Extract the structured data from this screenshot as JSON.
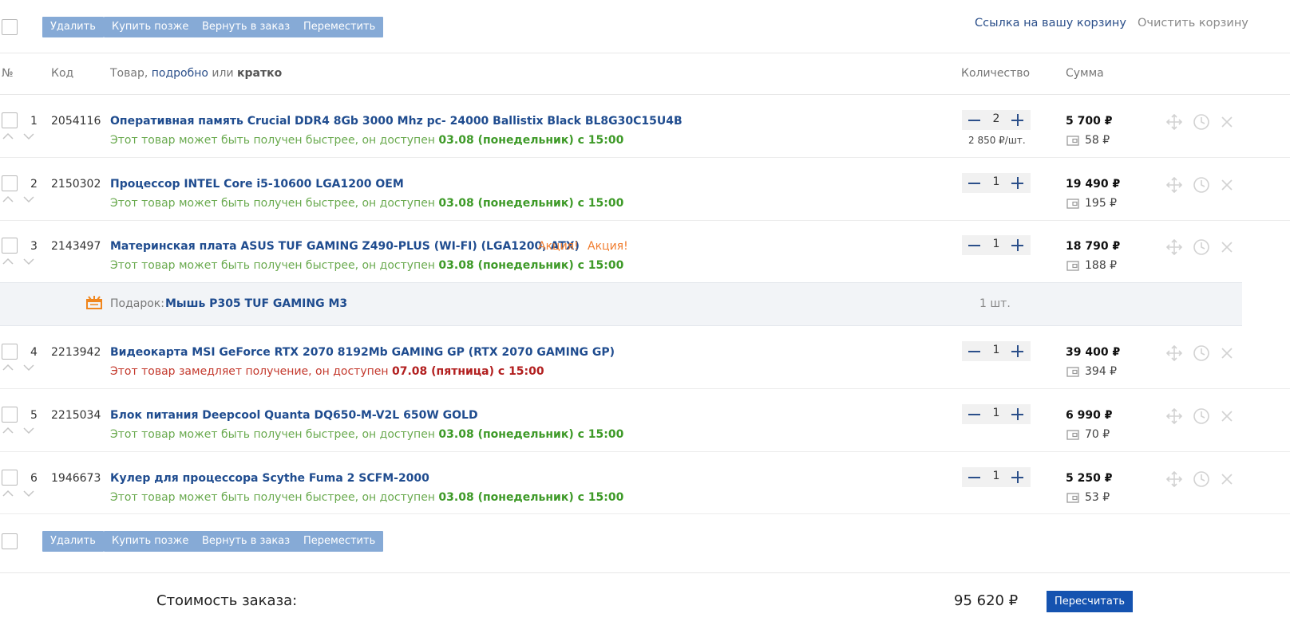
{
  "toolbar": {
    "delete_label": "Удалить",
    "buy_later_label": "Купить позже",
    "return_label": "Вернуть в заказ",
    "move_label": "Переместить"
  },
  "top_links": {
    "cart_link": "Ссылка на вашу корзину",
    "clear_cart": "Очистить корзину"
  },
  "table_header": {
    "num": "№",
    "code": "Код",
    "product_prefix": "Товар,",
    "detailed": "подробно",
    "or": "или",
    "brief": "кратко",
    "quantity": "Количество",
    "sum": "Сумма"
  },
  "items": [
    {
      "num": "1",
      "code": "2054116",
      "title": "Оперативная память Crucial DDR4 8Gb 3000 Mhz pc- 24000 Ballistix Black BL8G30C15U4B",
      "avail_text": "Этот товар может быть получен быстрее, он доступен",
      "avail_date": "03.08 (понедельник) с 15:00",
      "qty": "2",
      "unit_price": "2 850 ₽/шт.",
      "price": "5 700 ₽",
      "bonus": "58 ₽"
    },
    {
      "num": "2",
      "code": "2150302",
      "title": "Процессор INTEL Core i5-10600 LGA1200 OEM",
      "avail_text": "Этот товар может быть получен быстрее, он доступен",
      "avail_date": "03.08 (понедельник) с 15:00",
      "qty": "1",
      "price": "19 490 ₽",
      "bonus": "195 ₽"
    },
    {
      "num": "3",
      "code": "2143497",
      "title": "Материнская плата ASUS TUF GAMING Z490-PLUS (WI-FI) (LGA1200, ATX)",
      "promo1": "Акция!",
      "promo2": "Акция!",
      "avail_text": "Этот товар может быть получен быстрее, он доступен",
      "avail_date": "03.08 (понедельник) с 15:00",
      "qty": "1",
      "price": "18 790 ₽",
      "bonus": "188 ₽"
    },
    {
      "num": "4",
      "code": "2213942",
      "title": "Видеокарта MSI GeForce RTX 2070 8192Mb GAMING GP (RTX 2070 GAMING GP)",
      "avail_text": "Этот товар замедляет получение, он доступен",
      "avail_date": "07.08 (пятница) с 15:00",
      "qty": "1",
      "price": "39 400 ₽",
      "bonus": "394 ₽"
    },
    {
      "num": "5",
      "code": "2215034",
      "title": "Блок питания Deepcool Quanta DQ650-M-V2L 650W GOLD",
      "avail_text": "Этот товар может быть получен быстрее, он доступен",
      "avail_date": "03.08 (понедельник) с 15:00",
      "qty": "1",
      "price": "6 990 ₽",
      "bonus": "70 ₽"
    },
    {
      "num": "6",
      "code": "1946673",
      "title": "Кулер для процессора Scythe Fuma 2 SCFM-2000",
      "avail_text": "Этот товар может быть получен быстрее, он доступен",
      "avail_date": "03.08 (понедельник) с 15:00",
      "qty": "1",
      "price": "5 250 ₽",
      "bonus": "53 ₽"
    }
  ],
  "gift": {
    "label": "Подарок:",
    "name": "Мышь P305 TUF GAMING M3",
    "qty": "1 шт."
  },
  "summary": {
    "label": "Стоимость заказа:",
    "total": "95 620 ₽",
    "recalc_label": "Пересчитать"
  },
  "colors": {
    "link_blue": "#1f4c8f",
    "button_blue": "#86aad6",
    "primary_button": "#1553b0",
    "available_green": "#3e9a28",
    "delayed_red": "#b21f1f",
    "promo_orange": "#f07c2e"
  },
  "icons": [
    "move-icon",
    "clock-icon",
    "close-icon",
    "wallet-icon",
    "gift-icon",
    "chevron-up-icon",
    "chevron-down-icon",
    "minus-icon",
    "plus-icon"
  ]
}
